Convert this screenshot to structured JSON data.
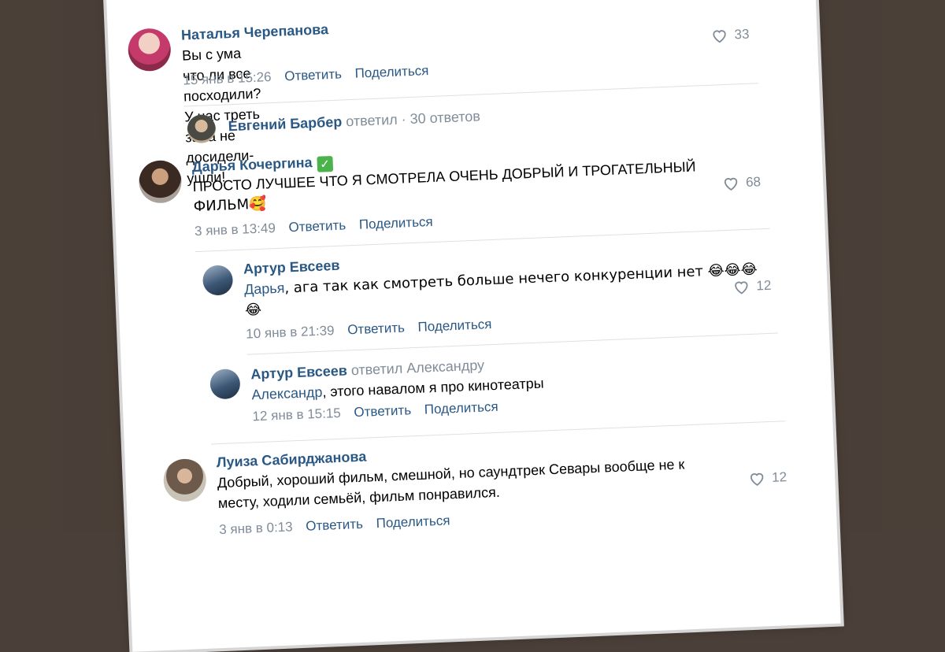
{
  "comments": {
    "c1": {
      "author": "Наталья Черепанова",
      "text": "Вы с ума что ли все посходили? У нас треть зала не досидели-ушли!",
      "date": "15 янв в 15:26",
      "reply": "Ответить",
      "share": "Поделиться",
      "likes": "33"
    },
    "c1_thread": {
      "author": "Евгений Барбер",
      "action": "ответил",
      "count": "· 30 ответов"
    },
    "c2": {
      "author": "Дарья Кочергина",
      "text_line1": "ПРОСТО ЛУЧШЕЕ ЧТО Я СМОТРЕЛА ОЧЕНЬ ДОБРЫЙ И ТРОГАТЕЛЬНЫЙ",
      "text_line2": "ФИЛЬМ🥰",
      "date": "3 янв в 13:49",
      "reply": "Ответить",
      "share": "Поделиться",
      "likes": "68"
    },
    "c3": {
      "author": "Артур Евсеев",
      "addressee": "Дарья",
      "text_line1": ", ага так как смотреть больше нечего конкуренции нет 😂😂😂",
      "text_line2": "😂",
      "date": "10 янв в 21:39",
      "reply": "Ответить",
      "share": "Поделиться",
      "likes": "12"
    },
    "c4": {
      "author": "Артур Евсеев",
      "replied_to": "ответил Александру",
      "addressee": "Александр",
      "text": ", этого навалом я про кинотеатры",
      "date": "12 янв в 15:15",
      "reply": "Ответить",
      "share": "Поделиться"
    },
    "c5": {
      "author": "Луиза Сабирджанова",
      "text_line1": "Добрый, хороший фильм, смешной, но саундтрек Севары вообще не к",
      "text_line2": "месту, ходили семьёй, фильм понравился.",
      "date": "3 янв в 0:13",
      "reply": "Ответить",
      "share": "Поделиться",
      "likes": "12"
    }
  },
  "icons": {
    "like": "heart-outline-icon",
    "verified": "check-icon"
  },
  "colors": {
    "link": "#2a5885",
    "muted": "#818c99",
    "background": "#4a3f39",
    "divider": "#dce1e6"
  }
}
